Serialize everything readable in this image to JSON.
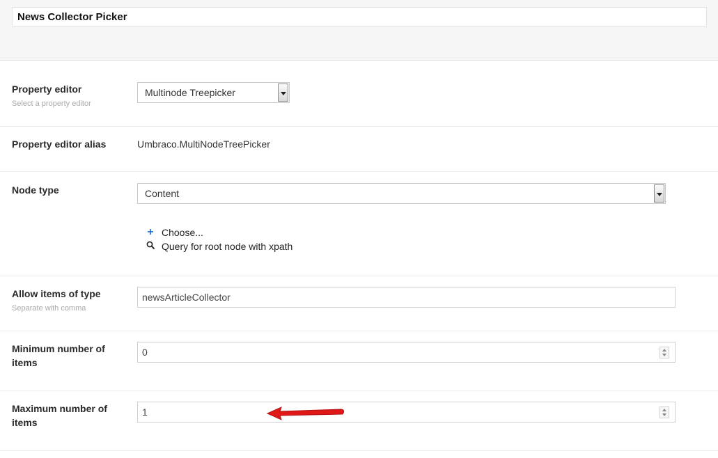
{
  "header": {
    "title": "News Collector Picker"
  },
  "property_editor": {
    "label": "Property editor",
    "description": "Select a property editor",
    "selected": "Multinode Treepicker"
  },
  "property_editor_alias": {
    "label": "Property editor alias",
    "value": "Umbraco.MultiNodeTreePicker"
  },
  "node_type": {
    "label": "Node type",
    "selected": "Content",
    "actions": {
      "choose": "Choose...",
      "query": "Query for root node with xpath"
    }
  },
  "allow_items": {
    "label": "Allow items of type",
    "description": "Separate with comma",
    "value": "newsArticleCollector"
  },
  "min_items": {
    "label_line1": "Minimum number of",
    "label_line2": "items",
    "value": "0"
  },
  "max_items": {
    "label_line1": "Maximum number of",
    "label_line2": "items",
    "value": "1"
  },
  "icons": {
    "add": "plus-icon",
    "search": "search-icon",
    "annotation": "red-arrow-icon"
  },
  "colors": {
    "accent": "#2b7bd1",
    "annotation": "#e01818"
  }
}
